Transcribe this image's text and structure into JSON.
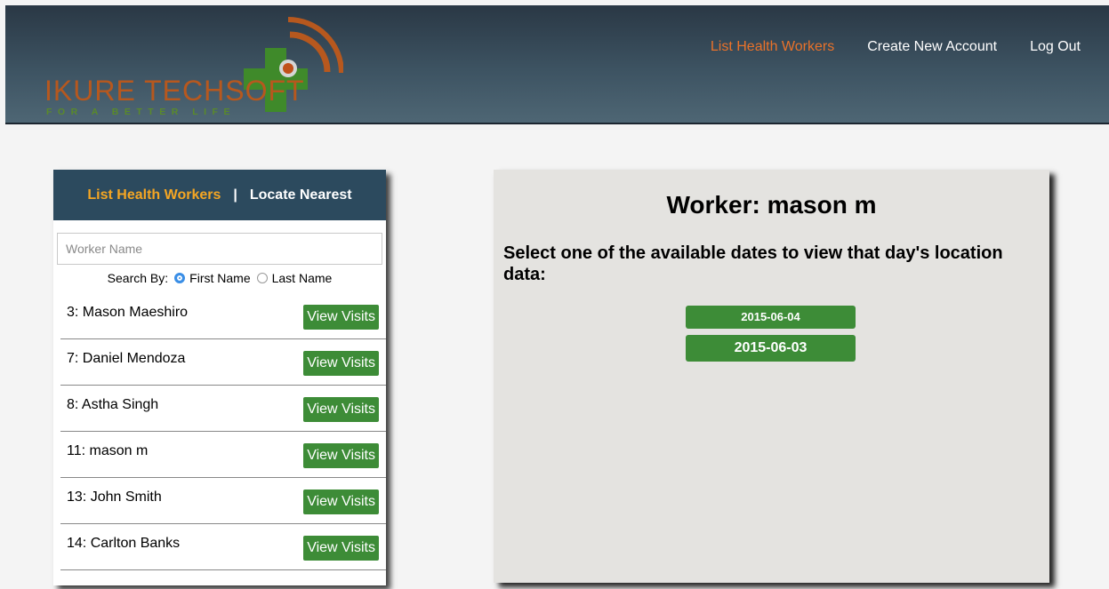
{
  "brand": {
    "name": "IKURE TECHSOFT",
    "tagline": "FOR A BETTER LIFE"
  },
  "nav": {
    "items": [
      "List Health Workers",
      "Create New Account",
      "Log Out"
    ],
    "active": "List Health Workers"
  },
  "left_panel": {
    "tab_list": "List Health Workers",
    "separator": "|",
    "tab_locate": "Locate Nearest",
    "search_placeholder": "Worker Name",
    "search_by_label": "Search By:",
    "option_first": "First Name",
    "option_last": "Last Name",
    "selected_option": "First Name",
    "view_label": "View Visits",
    "workers": [
      {
        "name": "3: Mason Maeshiro"
      },
      {
        "name": "7: Daniel Mendoza"
      },
      {
        "name": "8: Astha Singh"
      },
      {
        "name": "11: mason m"
      },
      {
        "name": "13: John Smith"
      },
      {
        "name": "14: Carlton Banks"
      }
    ]
  },
  "right_panel": {
    "title": "Worker: mason m",
    "instruction": "Select one of the available dates to view that day's location data:",
    "dates": [
      "2015-06-04",
      "2015-06-03"
    ]
  },
  "colors": {
    "accent": "#e9722a",
    "button": "#3d8c37",
    "panel_header": "#2c4a5e"
  }
}
